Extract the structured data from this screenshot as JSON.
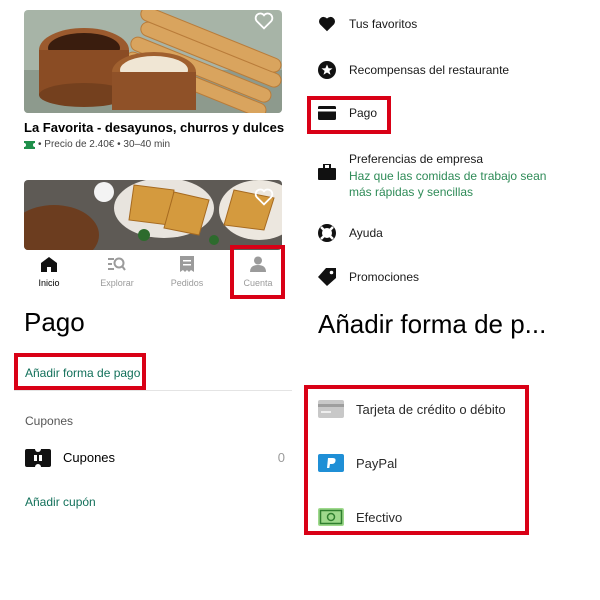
{
  "restaurants": [
    {
      "name": "La Favorita - desayunos, churros y dulces",
      "meta": "• Precio de 2.40€ • 30–40 min"
    },
    {
      "name": ""
    }
  ],
  "bottom_nav": {
    "items": [
      {
        "label": "Inicio",
        "icon": "home-icon",
        "active": true
      },
      {
        "label": "Explorar",
        "icon": "explore-icon",
        "active": false
      },
      {
        "label": "Pedidos",
        "icon": "receipt-icon",
        "active": false
      },
      {
        "label": "Cuenta",
        "icon": "person-icon",
        "active": false
      }
    ]
  },
  "account_menu": {
    "items": [
      {
        "label": "Tus favoritos",
        "icon": "heart-icon"
      },
      {
        "label": "Recompensas del restaurante",
        "icon": "star-badge-icon"
      },
      {
        "label": "Pago",
        "icon": "card-icon"
      },
      {
        "label": "Preferencias de empresa",
        "icon": "briefcase-icon",
        "subtitle": "Haz que las comidas de trabajo sean más rápidas y sencillas"
      },
      {
        "label": "Ayuda",
        "icon": "lifebuoy-icon"
      },
      {
        "label": "Promociones",
        "icon": "tag-icon"
      }
    ]
  },
  "payment": {
    "title": "Pago",
    "add_payment_link": "Añadir forma de pago",
    "coupons_header": "Cupones",
    "coupons_row_label": "Cupones",
    "coupons_count": "0",
    "add_coupon_link": "Añadir cupón"
  },
  "add_payment": {
    "title": "Añadir forma de p...",
    "methods": [
      {
        "label": "Tarjeta de crédito o débito",
        "icon": "credit-card-icon"
      },
      {
        "label": "PayPal",
        "icon": "paypal-icon"
      },
      {
        "label": "Efectivo",
        "icon": "cash-icon"
      }
    ]
  },
  "colors": {
    "highlight": "#d90016",
    "link_green": "#12705a",
    "subtitle_green": "#2e8b57",
    "text": "#1a1a1a",
    "muted": "#9b9b9b"
  }
}
